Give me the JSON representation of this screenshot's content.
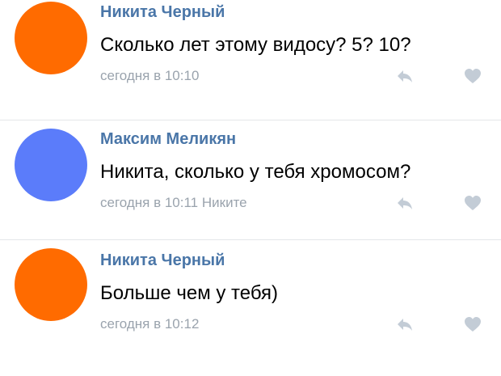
{
  "colors": {
    "author_link": "#4a76a8",
    "meta_text": "#9aa3ad",
    "icon": "#c3ccd6",
    "divider": "#e4e6e9"
  },
  "comments": [
    {
      "avatar_color": "#ff6b00",
      "author": "Никита Черный",
      "text": "Сколько лет этому видосу? 5? 10?",
      "meta": "сегодня в 10:10",
      "actions": [
        "reply-icon",
        "like-icon"
      ]
    },
    {
      "avatar_color": "#5b7cfa",
      "author": "Максим Меликян",
      "text": "Никита, сколько у тебя хромосом?",
      "meta": "сегодня в 10:11 Никите",
      "actions": [
        "reply-icon",
        "like-icon"
      ]
    },
    {
      "avatar_color": "#ff6b00",
      "author": "Никита Черный",
      "text": "Больше чем у тебя)",
      "meta": "сегодня в 10:12",
      "actions": [
        "reply-icon",
        "like-icon"
      ]
    }
  ]
}
